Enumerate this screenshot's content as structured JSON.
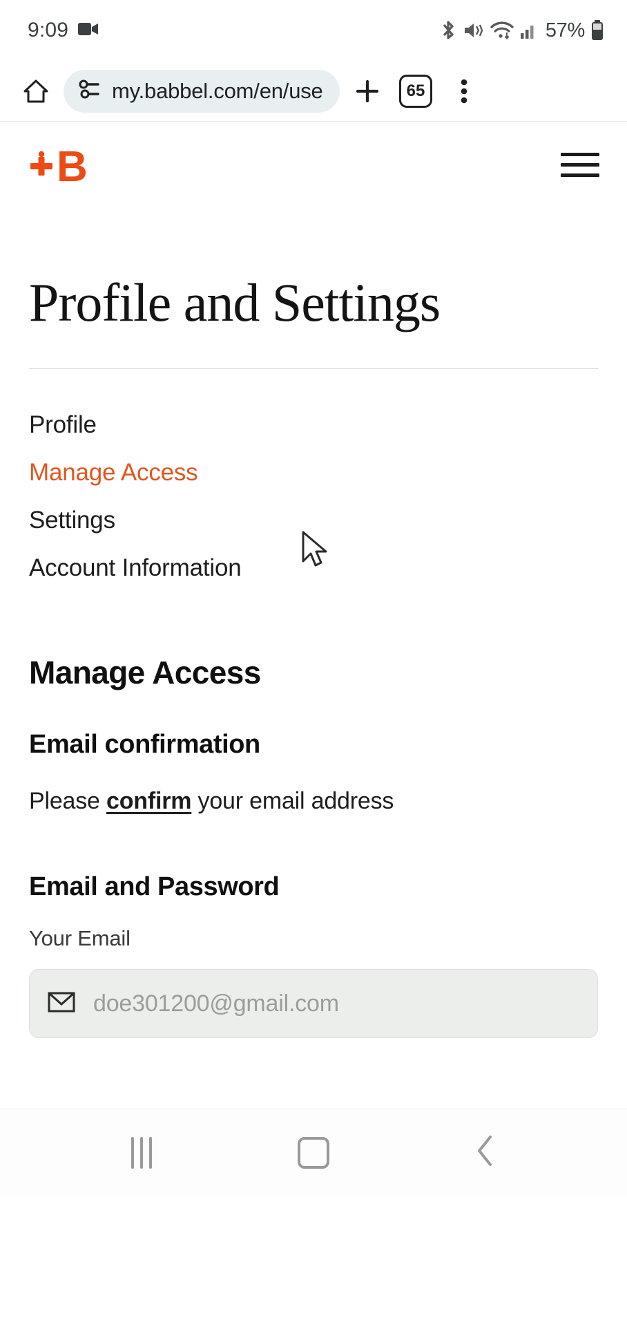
{
  "status_bar": {
    "clock": "9:09",
    "battery_percent": "57%",
    "icons": [
      "video-camera-icon",
      "bluetooth-icon",
      "mute-vibrate-icon",
      "wifi-icon",
      "cellular-signal-icon",
      "battery-icon"
    ]
  },
  "browser": {
    "url": "my.babbel.com/en/use",
    "tab_count": "65",
    "icons": [
      "home-icon",
      "page-info-icon",
      "new-tab-icon",
      "tab-switcher-icon",
      "more-options-icon"
    ]
  },
  "site": {
    "logo_text": "+B",
    "logo_color": "#ec4b14",
    "menu_icon": "hamburger-menu-icon"
  },
  "page": {
    "title": "Profile and Settings",
    "nav": [
      {
        "label": "Profile",
        "active": false
      },
      {
        "label": "Manage Access",
        "active": true
      },
      {
        "label": "Settings",
        "active": false
      },
      {
        "label": "Account Information",
        "active": false
      }
    ],
    "section_heading": "Manage Access",
    "email_confirmation": {
      "heading": "Email confirmation",
      "text_before": "Please ",
      "link": "confirm",
      "text_after": " your email address"
    },
    "email_and_password": {
      "heading": "Email and Password",
      "field_label": "Your Email",
      "email_value": "doe301200@gmail.com",
      "email_icon": "envelope-icon"
    }
  },
  "android_nav": {
    "recents_label": "recent-apps",
    "home_label": "home",
    "back_label": "back"
  },
  "colors": {
    "accent_orange": "#e2561e",
    "logo_orange": "#ec4b14",
    "omnibox_bg": "#e8eff1",
    "input_bg": "#eceeec"
  }
}
